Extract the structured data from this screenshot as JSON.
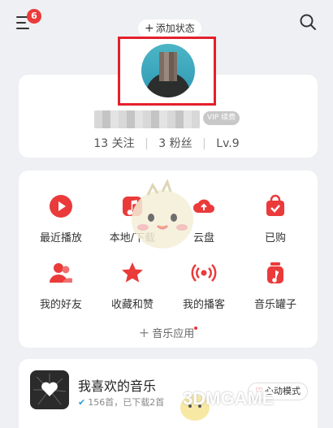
{
  "header": {
    "badge_count": "6",
    "add_status_label": "添加状态"
  },
  "profile": {
    "vip_label": "VIP 续费",
    "stats": [
      {
        "value": "13",
        "label": "关注"
      },
      {
        "value": "3",
        "label": "粉丝"
      },
      {
        "value": "Lv.9",
        "label": ""
      }
    ]
  },
  "apps": {
    "items": [
      {
        "label": "最近播放",
        "icon": "play-circle-icon"
      },
      {
        "label": "本地/下载",
        "icon": "local-music-icon"
      },
      {
        "label": "云盘",
        "icon": "cloud-icon"
      },
      {
        "label": "已购",
        "icon": "purchased-bag-icon"
      },
      {
        "label": "我的好友",
        "icon": "friends-icon"
      },
      {
        "label": "收藏和赞",
        "icon": "star-icon"
      },
      {
        "label": "我的播客",
        "icon": "podcast-icon"
      },
      {
        "label": "音乐罐子",
        "icon": "music-jar-icon"
      }
    ],
    "more_label": "音乐应用"
  },
  "playlist": {
    "title": "我喜欢的音乐",
    "subtitle": "156首，已下载2首",
    "mode_label": "心动模式"
  },
  "watermark": "3DMGAME",
  "colors": {
    "accent": "#ea3a3a",
    "background": "#eef0f3",
    "highlight_box": "#e41f2c"
  }
}
